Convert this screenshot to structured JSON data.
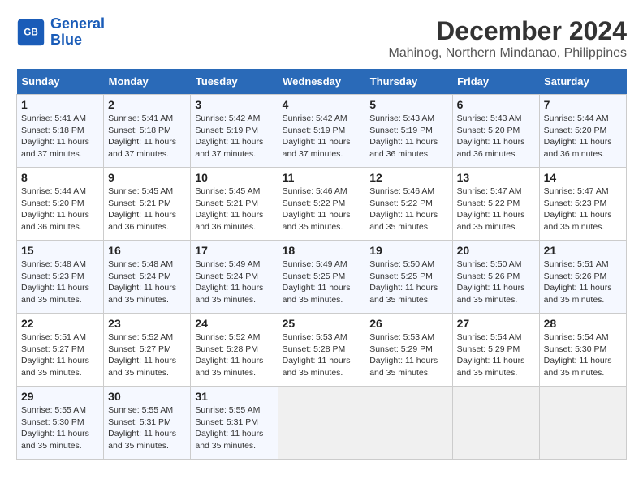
{
  "logo": {
    "name_line1": "General",
    "name_line2": "Blue"
  },
  "header": {
    "month_year": "December 2024",
    "location": "Mahinog, Northern Mindanao, Philippines"
  },
  "weekdays": [
    "Sunday",
    "Monday",
    "Tuesday",
    "Wednesday",
    "Thursday",
    "Friday",
    "Saturday"
  ],
  "weeks": [
    [
      {
        "day": "1",
        "sunrise": "5:41 AM",
        "sunset": "5:18 PM",
        "daylight": "11 hours and 37 minutes."
      },
      {
        "day": "2",
        "sunrise": "5:41 AM",
        "sunset": "5:18 PM",
        "daylight": "11 hours and 37 minutes."
      },
      {
        "day": "3",
        "sunrise": "5:42 AM",
        "sunset": "5:19 PM",
        "daylight": "11 hours and 37 minutes."
      },
      {
        "day": "4",
        "sunrise": "5:42 AM",
        "sunset": "5:19 PM",
        "daylight": "11 hours and 37 minutes."
      },
      {
        "day": "5",
        "sunrise": "5:43 AM",
        "sunset": "5:19 PM",
        "daylight": "11 hours and 36 minutes."
      },
      {
        "day": "6",
        "sunrise": "5:43 AM",
        "sunset": "5:20 PM",
        "daylight": "11 hours and 36 minutes."
      },
      {
        "day": "7",
        "sunrise": "5:44 AM",
        "sunset": "5:20 PM",
        "daylight": "11 hours and 36 minutes."
      }
    ],
    [
      {
        "day": "8",
        "sunrise": "5:44 AM",
        "sunset": "5:20 PM",
        "daylight": "11 hours and 36 minutes."
      },
      {
        "day": "9",
        "sunrise": "5:45 AM",
        "sunset": "5:21 PM",
        "daylight": "11 hours and 36 minutes."
      },
      {
        "day": "10",
        "sunrise": "5:45 AM",
        "sunset": "5:21 PM",
        "daylight": "11 hours and 36 minutes."
      },
      {
        "day": "11",
        "sunrise": "5:46 AM",
        "sunset": "5:22 PM",
        "daylight": "11 hours and 35 minutes."
      },
      {
        "day": "12",
        "sunrise": "5:46 AM",
        "sunset": "5:22 PM",
        "daylight": "11 hours and 35 minutes."
      },
      {
        "day": "13",
        "sunrise": "5:47 AM",
        "sunset": "5:22 PM",
        "daylight": "11 hours and 35 minutes."
      },
      {
        "day": "14",
        "sunrise": "5:47 AM",
        "sunset": "5:23 PM",
        "daylight": "11 hours and 35 minutes."
      }
    ],
    [
      {
        "day": "15",
        "sunrise": "5:48 AM",
        "sunset": "5:23 PM",
        "daylight": "11 hours and 35 minutes."
      },
      {
        "day": "16",
        "sunrise": "5:48 AM",
        "sunset": "5:24 PM",
        "daylight": "11 hours and 35 minutes."
      },
      {
        "day": "17",
        "sunrise": "5:49 AM",
        "sunset": "5:24 PM",
        "daylight": "11 hours and 35 minutes."
      },
      {
        "day": "18",
        "sunrise": "5:49 AM",
        "sunset": "5:25 PM",
        "daylight": "11 hours and 35 minutes."
      },
      {
        "day": "19",
        "sunrise": "5:50 AM",
        "sunset": "5:25 PM",
        "daylight": "11 hours and 35 minutes."
      },
      {
        "day": "20",
        "sunrise": "5:50 AM",
        "sunset": "5:26 PM",
        "daylight": "11 hours and 35 minutes."
      },
      {
        "day": "21",
        "sunrise": "5:51 AM",
        "sunset": "5:26 PM",
        "daylight": "11 hours and 35 minutes."
      }
    ],
    [
      {
        "day": "22",
        "sunrise": "5:51 AM",
        "sunset": "5:27 PM",
        "daylight": "11 hours and 35 minutes."
      },
      {
        "day": "23",
        "sunrise": "5:52 AM",
        "sunset": "5:27 PM",
        "daylight": "11 hours and 35 minutes."
      },
      {
        "day": "24",
        "sunrise": "5:52 AM",
        "sunset": "5:28 PM",
        "daylight": "11 hours and 35 minutes."
      },
      {
        "day": "25",
        "sunrise": "5:53 AM",
        "sunset": "5:28 PM",
        "daylight": "11 hours and 35 minutes."
      },
      {
        "day": "26",
        "sunrise": "5:53 AM",
        "sunset": "5:29 PM",
        "daylight": "11 hours and 35 minutes."
      },
      {
        "day": "27",
        "sunrise": "5:54 AM",
        "sunset": "5:29 PM",
        "daylight": "11 hours and 35 minutes."
      },
      {
        "day": "28",
        "sunrise": "5:54 AM",
        "sunset": "5:30 PM",
        "daylight": "11 hours and 35 minutes."
      }
    ],
    [
      {
        "day": "29",
        "sunrise": "5:55 AM",
        "sunset": "5:30 PM",
        "daylight": "11 hours and 35 minutes."
      },
      {
        "day": "30",
        "sunrise": "5:55 AM",
        "sunset": "5:31 PM",
        "daylight": "11 hours and 35 minutes."
      },
      {
        "day": "31",
        "sunrise": "5:55 AM",
        "sunset": "5:31 PM",
        "daylight": "11 hours and 35 minutes."
      },
      null,
      null,
      null,
      null
    ]
  ]
}
